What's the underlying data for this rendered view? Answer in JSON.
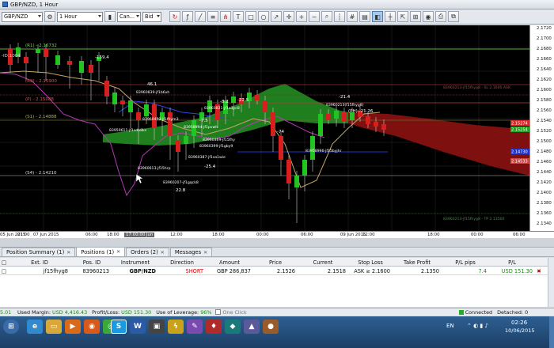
{
  "window": {
    "title": "GBP/NZD, 1 Hour"
  },
  "toolbar": {
    "instrument": "GBP/NZD",
    "period": "1 Hour",
    "chart_type": "Can...",
    "price_side": "Bid"
  },
  "chart": {
    "background": "#000000",
    "y_ticks": [
      "2.1720",
      "2.1700",
      "2.1680",
      "2.1660",
      "2.1640",
      "2.1620",
      "2.1600",
      "2.1580",
      "2.1560",
      "2.1540",
      "2.1520",
      "2.1500",
      "2.1480",
      "2.1460",
      "2.1440",
      "2.1420",
      "2.1400",
      "2.1380",
      "2.1360",
      "2.1340"
    ],
    "price_badges": [
      {
        "text": "2.15274",
        "color": "#d92a2a"
      },
      {
        "text": "2.15254",
        "color": "#22a022"
      },
      {
        "text": "2.14730",
        "color": "#2233cc"
      },
      {
        "text": "2.14533",
        "color": "#c84848"
      }
    ],
    "x_ticks": [
      "05 Jun 2015",
      "21:00",
      "07 Jun 2015",
      "06:00",
      "18:00",
      "00:00 Jun",
      "12:00",
      "18:00",
      "00:00",
      "06:00",
      "09 Jun 2015",
      "12:00",
      "18:00",
      "00:00",
      "06:00",
      "12:00",
      "10 Jun 2015",
      "18:00",
      "00:00"
    ],
    "cursor_time": "17:00:00 Jun",
    "labels": [
      "(R1) - 2.16732",
      "(R2) - 2.15900",
      "(P) - 2.15088",
      "(S1) - 2.14888",
      "(S4) - 2.14210",
      "-ID:1004"
    ],
    "annotations": [
      "-159.4",
      "46.1",
      "-22.5",
      "-21.4",
      "-8.2",
      "-7.5",
      "-74",
      "-25.4",
      "22.8",
      "(PH):-21.26"
    ],
    "order_labels": [
      "83960213-jf15fhyg8",
      "83960213-jf15fhyg8 - SL 2.1600 ASK",
      "83960213-jf15fhyg8 - TP 2.13500"
    ],
    "trade_tags": [
      "83960213(f15fhyg8)",
      "83959611-jf1sdb8ks",
      "83960839-jf1b6xh",
      "83960821-jf1a3yc8",
      "83960413-jf1fhym3",
      "83958994-jf1pvwh",
      "83960399-jf1gby9",
      "83960369-jf15fhy",
      "83960387-jf1sa1wie",
      "83960613-jf15hrp",
      "83958996-jf15byjhr",
      "83960207-jf1gqck8"
    ]
  },
  "panel_tabs": [
    {
      "label": "Position Summary (1)"
    },
    {
      "label": "Positions (1)",
      "active": true
    },
    {
      "label": "Orders (2)"
    },
    {
      "label": "Messages"
    }
  ],
  "positions_table": {
    "headers": [
      "Ext. ID",
      "Pos. ID",
      "Instrument",
      "Direction",
      "Amount",
      "Price",
      "Current",
      "Stop Loss",
      "Take Profit",
      "P/L pips",
      "P/L"
    ],
    "row": {
      "ext_id": "jf15fhyg8",
      "pos_id": "83960213",
      "instrument": "GBP/NZD",
      "direction": "SHORT",
      "amount": "GBP 286,837",
      "price": "2.1526",
      "current": "2.1518",
      "stop_loss": "ASK ≥ 2.1600",
      "take_profit": "2.1350",
      "pl_pips": "7.4",
      "pl": "USD 151.30"
    }
  },
  "status_bar": {
    "left_value": "5.01",
    "used_margin_label": "Used Margin:",
    "used_margin": "USD 4,416.43",
    "pl_label": "Profit/Loss:",
    "pl": "USD 151.30",
    "leverage_label": "Use of Leverage:",
    "leverage": "96%",
    "one_click": "One Click",
    "connected": "Connected",
    "detached": "Detached: 0"
  },
  "taskbar": {
    "lang": "EN",
    "time": "02:26",
    "date": "10/06/2015",
    "apps": [
      "ie",
      "folder",
      "media",
      "firefox",
      "chrome",
      "skype",
      "word",
      "terminal",
      "lightning",
      "paint",
      "game",
      "app12",
      "app13",
      "app14"
    ]
  },
  "colors": {
    "cloud_green": "#1f7f1f",
    "cloud_red": "#7f1010",
    "bull_candle": "#22c422",
    "bear_candle": "#d81f1f",
    "r1_line": "#5fae3a",
    "pivot_line": "#b83a3a",
    "blue_line": "#2233cc",
    "magenta_line": "#b43ab4"
  }
}
